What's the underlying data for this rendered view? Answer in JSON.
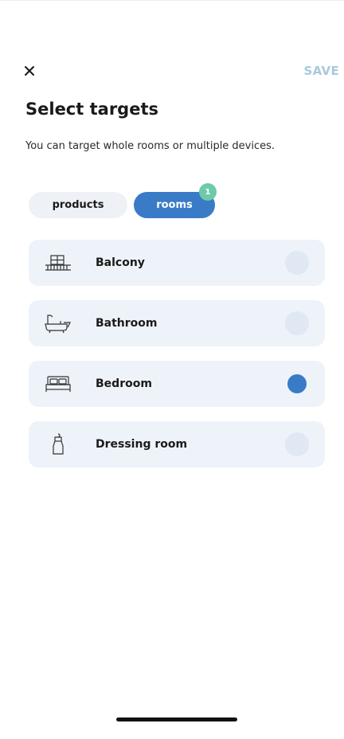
{
  "header": {
    "save_label": "SAVE"
  },
  "title": "Select targets",
  "subtitle": "You can target whole rooms or multiple devices.",
  "tabs": {
    "products_label": "products",
    "rooms_label": "rooms",
    "rooms_badge": "1",
    "active": "rooms"
  },
  "rooms": [
    {
      "label": "Balcony",
      "icon": "balcony-icon",
      "selected": false
    },
    {
      "label": "Bathroom",
      "icon": "bathtub-icon",
      "selected": false
    },
    {
      "label": "Bedroom",
      "icon": "bed-icon",
      "selected": true
    },
    {
      "label": "Dressing room",
      "icon": "dress-icon",
      "selected": false
    }
  ],
  "colors": {
    "accent": "#3a7bc8",
    "badge": "#6ccaa8",
    "save_disabled": "#a9c9dc",
    "row_bg": "#eef3f9"
  }
}
